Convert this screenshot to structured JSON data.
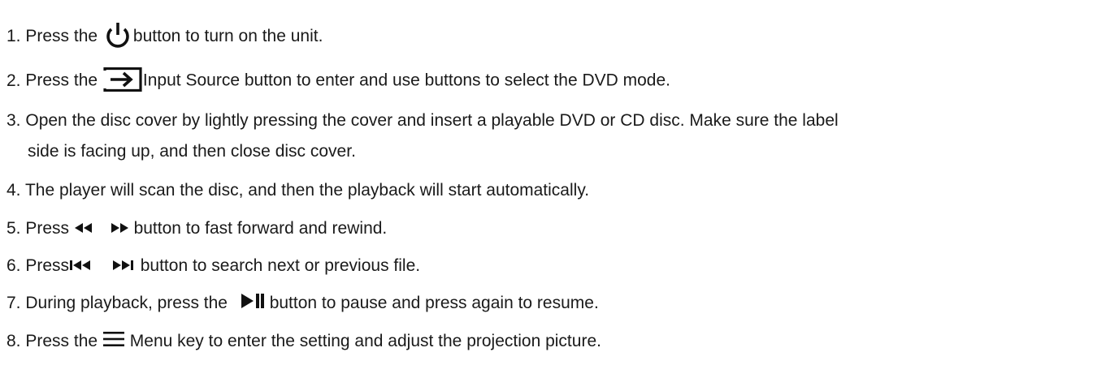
{
  "steps": [
    {
      "num": "1.",
      "pre": "Press the",
      "post": "button to turn on the unit.",
      "icon": "power-icon"
    },
    {
      "num": "2.",
      "pre": "Press the",
      "post": "Input Source button to enter and use buttons to select the DVD mode.",
      "icon": "input-source-icon"
    },
    {
      "num": "3.",
      "text": "Open the disc cover by lightly pressing the cover and insert a playable DVD or CD disc. Make sure the label",
      "cont": "side is facing up, and then close disc cover."
    },
    {
      "num": "4.",
      "text": "The player will scan the disc, and then the playback will start automatically."
    },
    {
      "num": "5.",
      "pre": "Press",
      "post": "button to fast forward and rewind.",
      "icons": [
        "rewind-icon",
        "fast-forward-icon"
      ]
    },
    {
      "num": "6.",
      "pre": "Press",
      "post": "button to search next or previous file.",
      "icons": [
        "previous-track-icon",
        "next-track-icon"
      ]
    },
    {
      "num": "7.",
      "pre": "During playback, press the",
      "post": "button to pause and press again to resume.",
      "icon": "play-pause-icon"
    },
    {
      "num": "8.",
      "pre": "Press the",
      "post": "Menu key to enter the setting and adjust the projection picture.",
      "icon": "menu-icon"
    }
  ]
}
